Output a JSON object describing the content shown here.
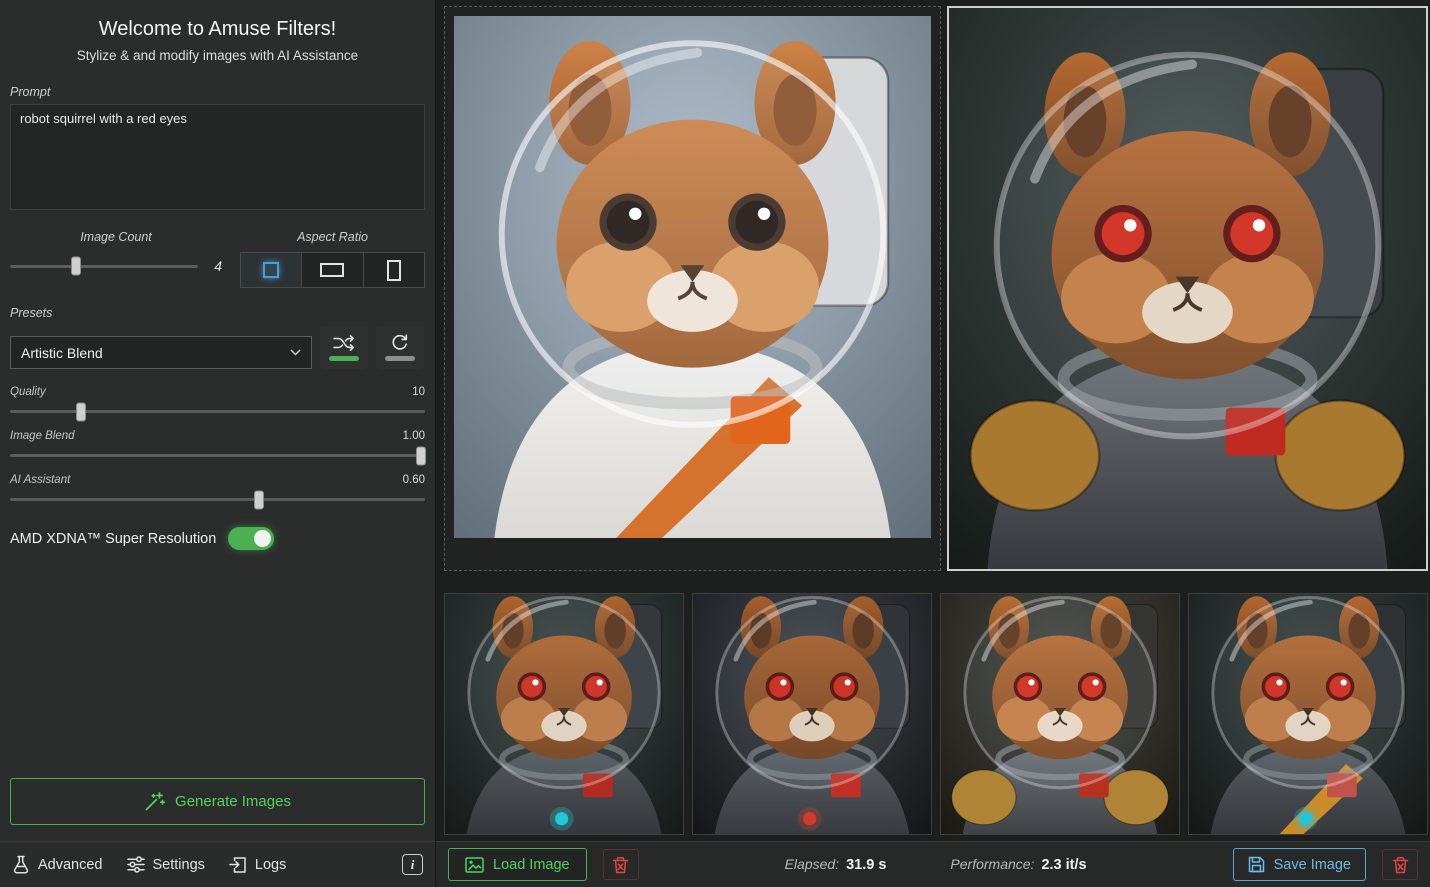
{
  "colors": {
    "accent_green": "#4cb052",
    "accent_green_bright": "#53d35c",
    "accent_blue": "#58a6d6",
    "accent_blue_bright": "#6fbbe8",
    "danger_red": "#e04545",
    "selected_blue": "#4a9fd8"
  },
  "sidebar": {
    "title": "Welcome to Amuse Filters!",
    "subtitle": "Stylize & and modify images with AI Assistance",
    "prompt": {
      "label": "Prompt",
      "value": "robot squirrel with a red eyes"
    },
    "image_count": {
      "label": "Image Count",
      "value": "4",
      "percent": 35
    },
    "aspect_ratio": {
      "label": "Aspect Ratio",
      "selected": "square"
    },
    "presets": {
      "label": "Presets",
      "selected": "Artistic Blend"
    },
    "sliders": [
      {
        "label": "Quality",
        "value": "10",
        "percent": 17
      },
      {
        "label": "Image Blend",
        "value": "1.00",
        "percent": 99
      },
      {
        "label": "AI Assistant",
        "value": "0.60",
        "percent": 60
      }
    ],
    "super_resolution": {
      "label": "AMD XDNA™ Super Resolution",
      "enabled": true
    },
    "generate_button": "Generate Images"
  },
  "sidebar_footer": {
    "advanced": "Advanced",
    "settings": "Settings",
    "logs": "Logs",
    "info": "i"
  },
  "statusbar": {
    "load_image": "Load Image",
    "elapsed_label": "Elapsed:",
    "elapsed_value": "31.9 s",
    "performance_label": "Performance:",
    "performance_value": "2.3 it/s",
    "save_image": "Save Image"
  },
  "gallery": {
    "input": "source astronaut squirrel photo",
    "output": "generated robot squirrel with red eyes",
    "thumbnails": [
      "variation 1",
      "variation 2",
      "variation 3",
      "variation 4"
    ]
  }
}
